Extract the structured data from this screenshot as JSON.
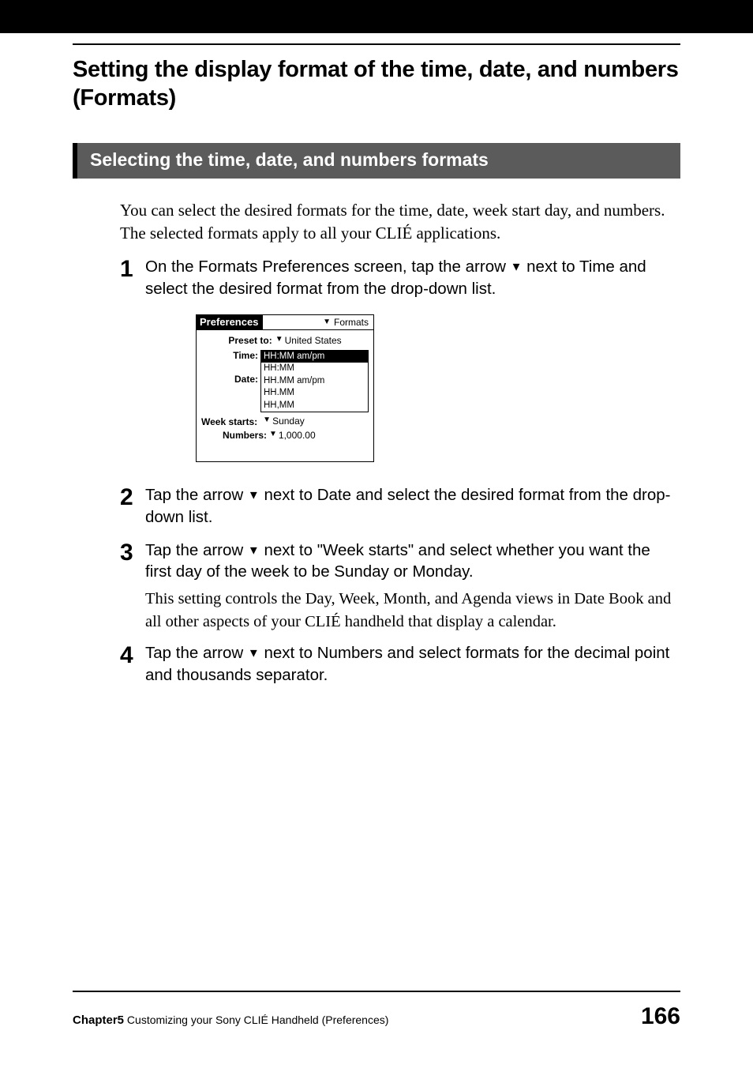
{
  "heading": "Setting the display format of the time, date, and numbers (Formats)",
  "subheading": "Selecting the time, date, and numbers formats",
  "intro": "You can select the desired formats for the time, date, week start day, and numbers. The selected formats apply to all your CLIÉ applications.",
  "arrow": "▼",
  "steps": {
    "s1": {
      "num": "1",
      "text_a": "On the Formats Preferences screen, tap the arrow ",
      "text_b": " next to Time and select the desired format from the drop-down list."
    },
    "s2": {
      "num": "2",
      "text_a": "Tap the arrow ",
      "text_b": " next to Date and select the desired format from the drop-down list."
    },
    "s3": {
      "num": "3",
      "text_a": "Tap the arrow ",
      "text_b": " next to \"Week starts\" and select whether you want the first day of the week to be Sunday or Monday.",
      "note": "This setting controls the Day, Week, Month, and Agenda views in Date Book and all other aspects of your CLIÉ handheld that display a calendar."
    },
    "s4": {
      "num": "4",
      "text_a": "Tap the arrow ",
      "text_b": " next to Numbers and select formats for the decimal point and thousands separator."
    }
  },
  "palm": {
    "title_left": "Preferences",
    "title_right": "Formats",
    "preset_label": "Preset to:",
    "preset_value": "United States",
    "time_label": "Time:",
    "date_label": "Date:",
    "dropdown": {
      "opt1": "HH:MM am/pm",
      "opt2": "HH:MM",
      "opt3": "HH.MM am/pm",
      "opt4": "HH.MM",
      "opt5": "HH,MM"
    },
    "week_label": "Week starts:",
    "week_value": "Sunday",
    "numbers_label": "Numbers:",
    "numbers_value": "1,000.00"
  },
  "footer": {
    "chapter_bold": "Chapter5",
    "chapter_text": "  Customizing your Sony CLIÉ Handheld (Preferences)",
    "page": "166"
  }
}
